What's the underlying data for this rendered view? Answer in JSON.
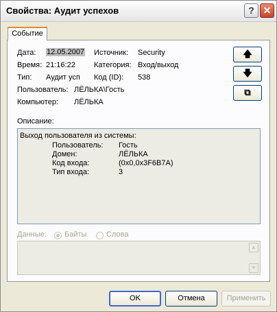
{
  "window": {
    "title": "Свойства: Аудит успехов",
    "help_glyph": "?",
    "close_glyph": "✕"
  },
  "tabs": [
    {
      "label": "Событие"
    }
  ],
  "event": {
    "date_label": "Дата:",
    "date_value": "12.05.2007",
    "time_label": "Время:",
    "time_value": "21:16:22",
    "type_label": "Тип:",
    "type_value": "Аудит усп",
    "user_label": "Пользователь:",
    "user_value": "ЛЁЛЬКА\\Гость",
    "computer_label": "Компьютер:",
    "computer_value": "ЛЁЛЬКА",
    "source_label": "Источник:",
    "source_value": "Security",
    "category_label": "Категория:",
    "category_value": "Вход/выход",
    "id_label": "Код (ID):",
    "id_value": "538"
  },
  "side_buttons": {
    "up": "🡅",
    "down": "🡇",
    "copy": "⧉"
  },
  "description": {
    "label": "Описание:",
    "title_line": "Выход пользователя из системы:",
    "rows": [
      {
        "key": "Пользователь:",
        "value": "Гость"
      },
      {
        "key": "Домен:",
        "value": "ЛЁЛЬКА"
      },
      {
        "key": "Код входа:",
        "value": "(0x0,0x3F6B7A)"
      },
      {
        "key": "Тип входа:",
        "value": "3"
      }
    ]
  },
  "data_section": {
    "label": "Данные:",
    "option_bytes": "Байты",
    "option_words": "Слова",
    "selected": "Байты"
  },
  "buttons": {
    "ok": "OK",
    "cancel": "Отмена",
    "apply": "Применить"
  }
}
